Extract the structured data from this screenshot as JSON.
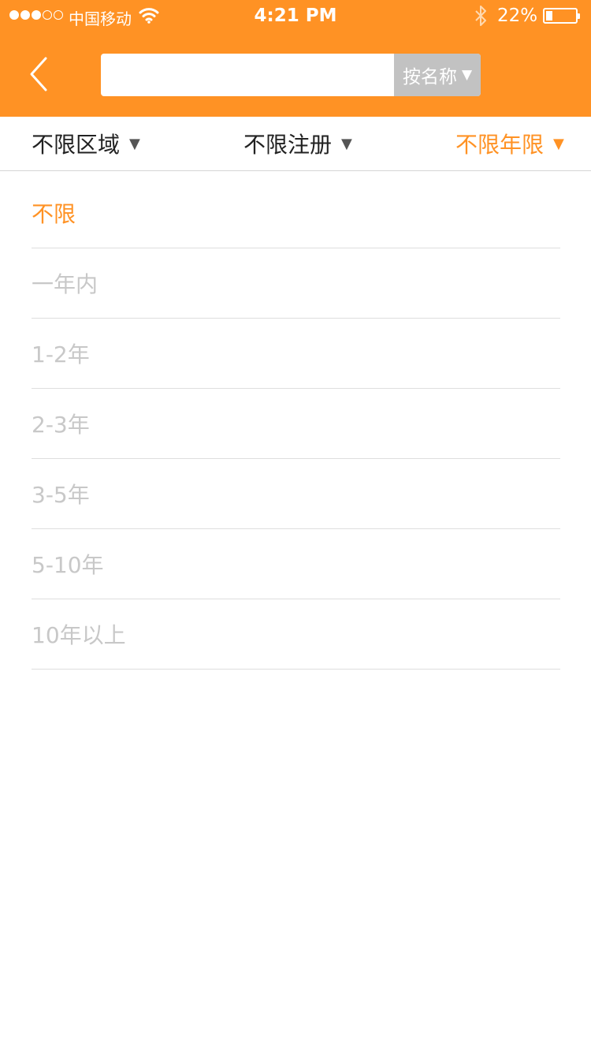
{
  "status_bar": {
    "carrier": "中国移动",
    "time": "4:21 PM",
    "battery_percent": "22%",
    "battery_level": 0.22,
    "signal_bars": 3,
    "signal_total": 5
  },
  "header": {
    "back_icon": "chevron-left-icon",
    "search": {
      "value": "",
      "placeholder": "",
      "type_label": "按名称",
      "type_arrow": "▼"
    },
    "background_color": "#ff9224"
  },
  "filters": {
    "area": {
      "label": "不限区域",
      "arrow": "▼"
    },
    "registration": {
      "label": "不限注册",
      "arrow": "▼"
    },
    "years": {
      "label": "不限年限",
      "arrow": "▼",
      "active": true
    }
  },
  "year_options": [
    {
      "label": "不限",
      "selected": true
    },
    {
      "label": "一年内",
      "selected": false
    },
    {
      "label": "1-2年",
      "selected": false
    },
    {
      "label": "2-3年",
      "selected": false
    },
    {
      "label": "3-5年",
      "selected": false
    },
    {
      "label": "5-10年",
      "selected": false
    },
    {
      "label": "10年以上",
      "selected": false
    }
  ],
  "colors": {
    "accent": "#ff9224",
    "option_text": "#c8c8c8",
    "search_type_bg": "#c2c2c2"
  }
}
